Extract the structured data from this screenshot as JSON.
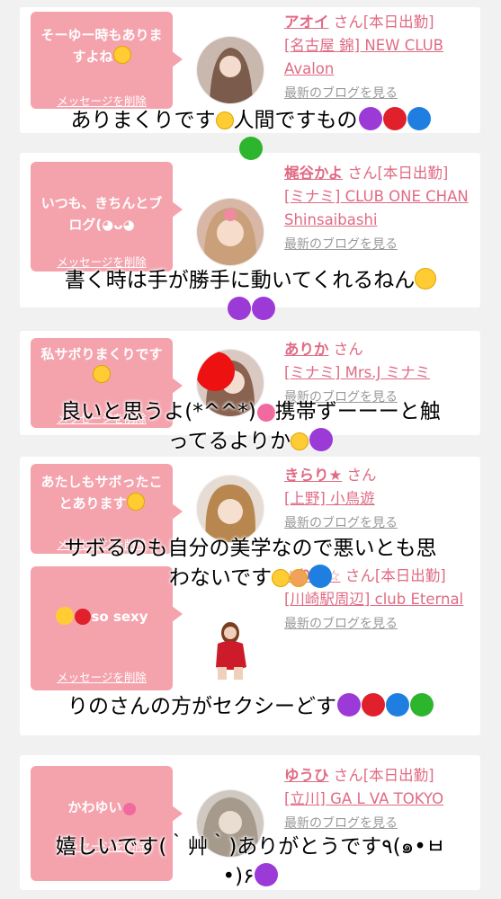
{
  "cards": [
    {
      "msg": "そーゆー時もありますよね",
      "name": "アオイ",
      "suffix": "さん[本日出勤]",
      "shop": "[名古屋 錦] NEW CLUB Avalon",
      "blog": "最新のブログを見る",
      "delete": "メッセージを削除"
    },
    {
      "msg": "いつも、きちんとブログ(◕ᴗ◕",
      "name": "梶谷かよ",
      "suffix": "さん[本日出勤]",
      "shop": "[ミナミ] CLUB ONE CHAN Shinsaibashi",
      "blog": "最新のブログを見る",
      "delete": "メッセージを削除"
    },
    {
      "msg": "私サボりまくりです",
      "name": "ありか",
      "suffix": "さん",
      "shop": "[ミナミ] Mrs.J ミナミ",
      "blog": "最新のブログを見る",
      "delete": "メッセージを削除"
    },
    {
      "msg": "あたしもサボったことあります",
      "name": "きらり★",
      "suffix": "さん",
      "shop": "[上野] 小鳥遊",
      "blog": "最新のブログを見る",
      "delete": "メッセージを削除"
    },
    {
      "msg": "so sexy",
      "name": "☆りの☆",
      "suffix": "さん[本日出勤]",
      "shop": "[川崎駅周辺] club Eternal",
      "blog": "最新のブログを見る",
      "delete": "メッセージを削除"
    },
    {
      "msg": "かわゆい",
      "name": "ゆうひ",
      "suffix": "さん[本日出勤]",
      "shop": "[立川] GA L VA TOKYO",
      "blog": "最新のブログを見る",
      "delete": "メッセージを削除"
    }
  ],
  "overlays": [
    {
      "l1": "ありまくりです",
      "l2": "人間ですもの"
    },
    {
      "l1": "書く時は手が勝手に動いてくれるねん"
    },
    {
      "l1": "良いと思うよ(*^^*)",
      "l2": "携帯ずーーーと触",
      "l3": "ってるよりか"
    },
    {
      "l1": "サボるのも自分の美学なので悪いとも思",
      "l2": "わないです"
    },
    {
      "l1": "りのさんの方がセクシーどす"
    },
    {
      "l1": "嬉しいです(｀艸｀)ありがとうです٩(๑•ㅂ",
      "l2": "•)۶"
    }
  ],
  "colors": {
    "bubble": "#f4a3ad",
    "accent": "#e06b84",
    "purple": "#9b3ad6",
    "red": "#e0202a",
    "blue": "#1e7fe0",
    "green": "#2db52d"
  }
}
